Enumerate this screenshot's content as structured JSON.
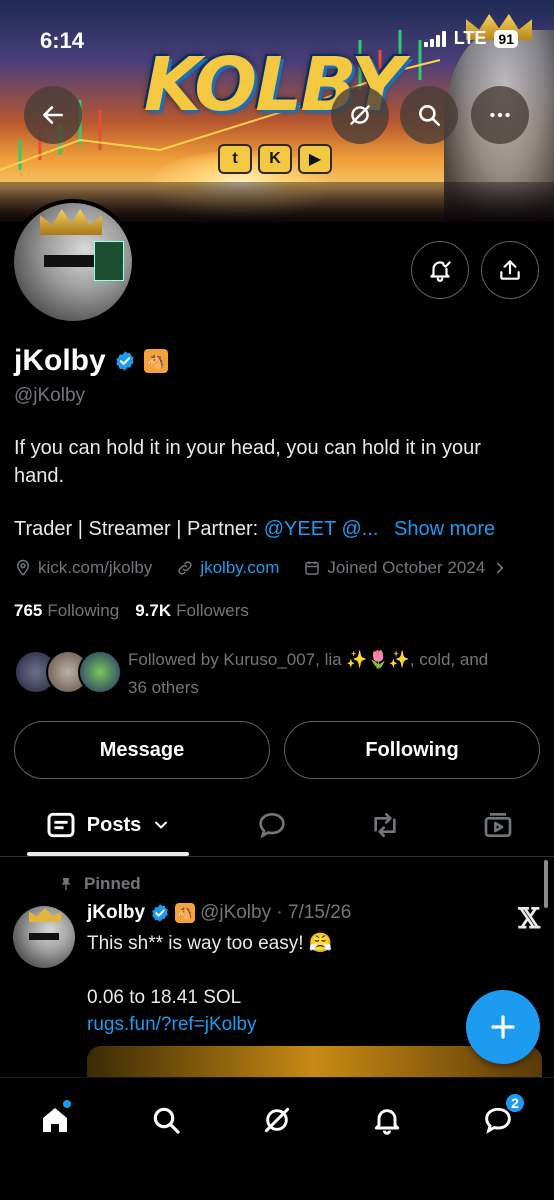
{
  "status_bar": {
    "time": "6:14",
    "network": "LTE",
    "battery": "91"
  },
  "banner": {
    "title": "KOLBY",
    "logos": [
      "t",
      "K",
      "▶"
    ]
  },
  "profile": {
    "name": "jKolby",
    "handle": "@jKolby",
    "bio_line": "If you can hold it in your head, you can hold it in your hand.",
    "bio_roles": "Trader | Streamer | Partner: ",
    "bio_mentions": "@YEET @...",
    "show_more": "Show more",
    "location": "kick.com/jkolby",
    "website": "jkolby.com",
    "joined": "Joined October 2024",
    "following_count": "765",
    "following_label": "Following",
    "followers_count": "9.7K",
    "followers_label": "Followers",
    "followed_by": "Followed by Kuruso_007, lia ✨🌷✨, cold, and 36 others"
  },
  "actions": {
    "message": "Message",
    "following": "Following"
  },
  "tabs": {
    "posts": "Posts"
  },
  "post": {
    "pinned_label": "Pinned",
    "name": "jKolby",
    "handle_date": "@jKolby · 7/15/26",
    "line1": "This sh** is way too easy! 😤",
    "line2": "0.06 to 18.41 SOL",
    "link": "rugs.fun/?ref=jKolby"
  },
  "nav": {
    "messages_badge": "2"
  },
  "colors": {
    "accent": "#1d9bf0",
    "muted": "#71767b",
    "background": "#000000"
  }
}
